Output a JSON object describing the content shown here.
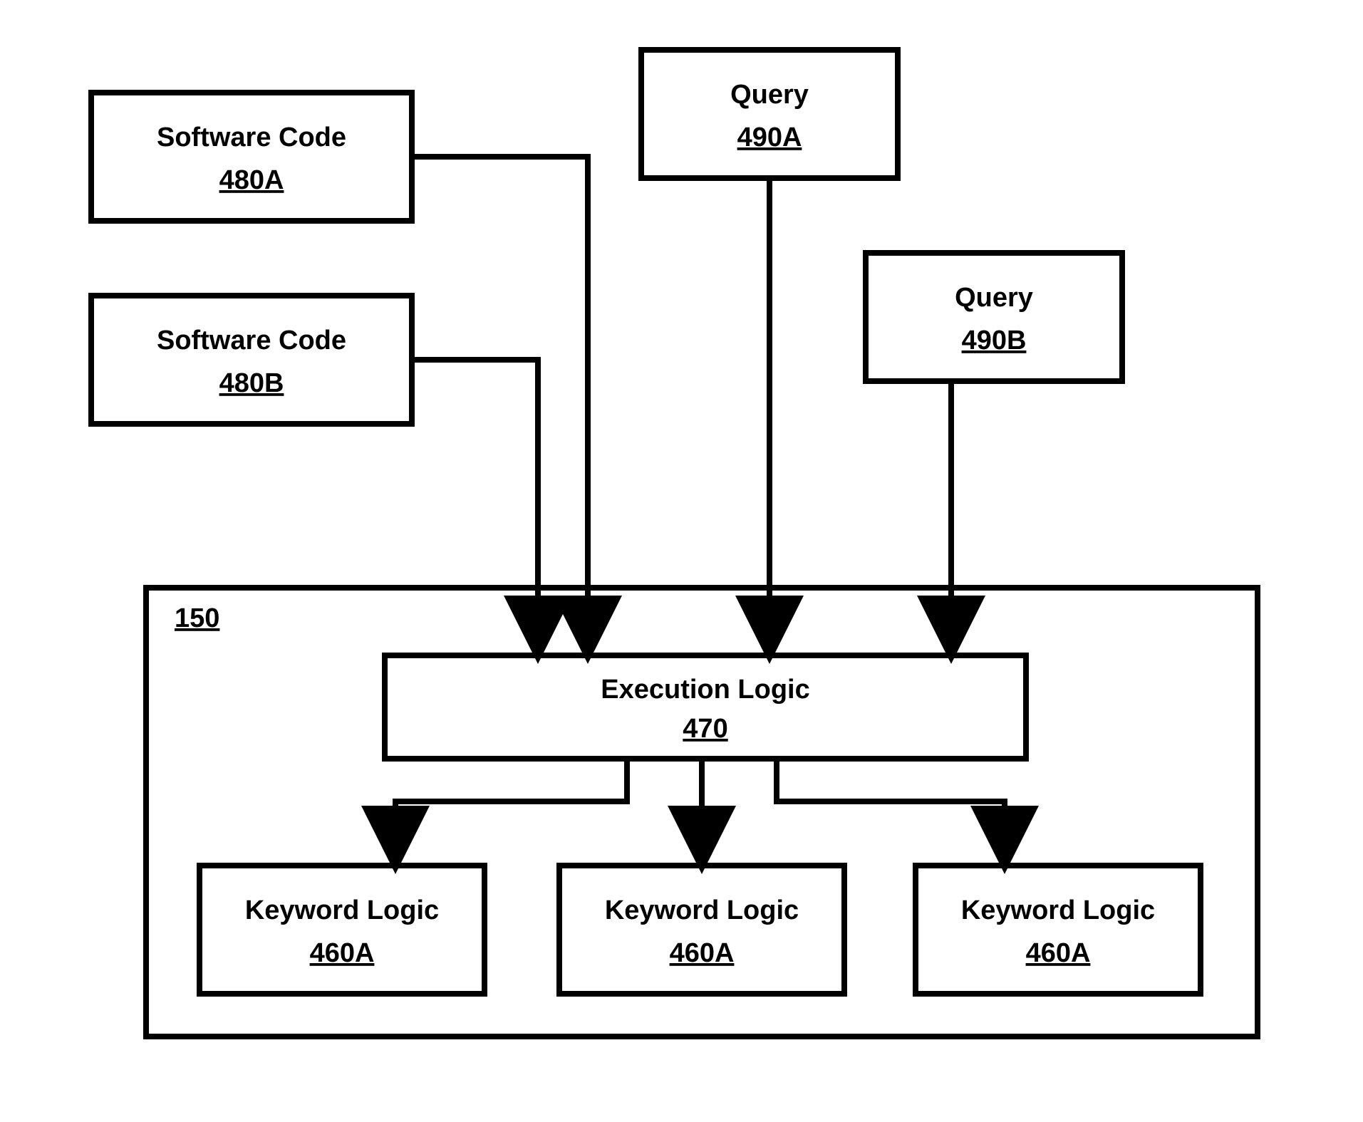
{
  "boxes": {
    "software_code_a": {
      "label": "Software Code",
      "ref": "480A"
    },
    "software_code_b": {
      "label": "Software Code",
      "ref": "480B"
    },
    "query_a": {
      "label": "Query",
      "ref": "490A"
    },
    "query_b": {
      "label": "Query",
      "ref": "490B"
    },
    "execution_logic": {
      "label": "Execution Logic",
      "ref": "470"
    },
    "keyword_logic_1": {
      "label": "Keyword  Logic",
      "ref": "460A"
    },
    "keyword_logic_2": {
      "label": "Keyword  Logic",
      "ref": "460A"
    },
    "keyword_logic_3": {
      "label": "Keyword  Logic",
      "ref": "460A"
    }
  },
  "container_ref": "150"
}
